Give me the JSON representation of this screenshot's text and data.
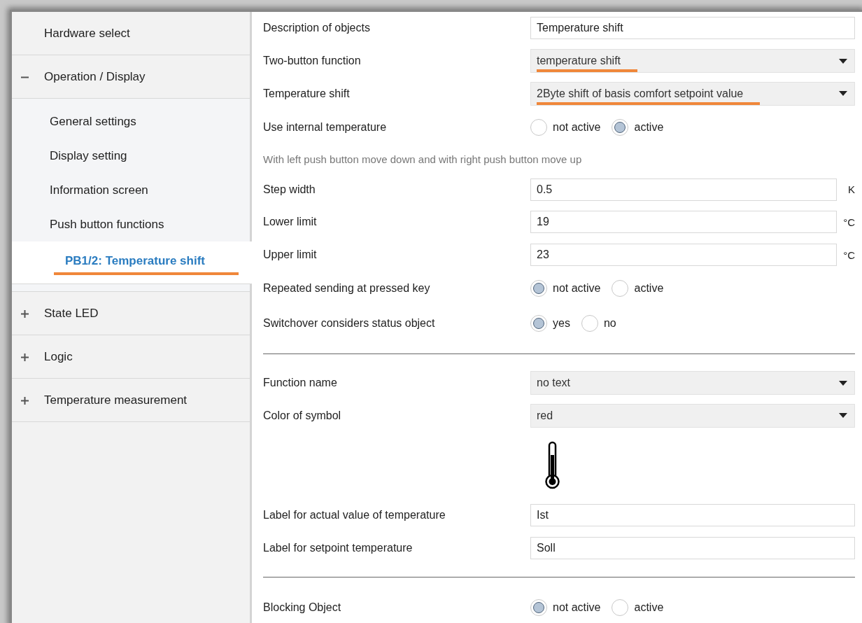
{
  "sidebar": {
    "items": [
      {
        "label": "Hardware select",
        "expandable": false,
        "selected": false
      },
      {
        "label": "Operation / Display",
        "expanded": true,
        "expandable": true,
        "selected": false,
        "children": [
          {
            "label": "General settings",
            "selected": false
          },
          {
            "label": "Display setting",
            "selected": false
          },
          {
            "label": "Information screen",
            "selected": false
          },
          {
            "label": "Push button functions",
            "selected": false,
            "children": [
              {
                "label": "PB1/2: Temperature shift",
                "selected": true
              }
            ]
          }
        ]
      },
      {
        "label": "State LED",
        "expanded": false,
        "expandable": true,
        "selected": false
      },
      {
        "label": "Logic",
        "expanded": false,
        "expandable": true,
        "selected": false
      },
      {
        "label": "Temperature measurement",
        "expanded": false,
        "expandable": true,
        "selected": false
      }
    ]
  },
  "parameters": [
    {
      "kind": "text",
      "label": "Description of objects",
      "value": "Temperature shift"
    },
    {
      "kind": "select",
      "label": "Two-button function",
      "value": "temperature shift",
      "highlighted": true
    },
    {
      "kind": "select",
      "label": "Temperature shift",
      "value": "2Byte shift of basis comfort setpoint value",
      "highlighted": true
    },
    {
      "kind": "radio",
      "label": "Use internal temperature",
      "options": [
        {
          "label": "not active",
          "selected": false
        },
        {
          "label": "active",
          "selected": true
        }
      ]
    },
    {
      "kind": "note",
      "label": "With left push button move down and with right push button move up"
    },
    {
      "kind": "number",
      "label": "Step width",
      "value": "0.5",
      "unit": "K"
    },
    {
      "kind": "number",
      "label": "Lower limit",
      "value": "19",
      "unit": "°C"
    },
    {
      "kind": "number",
      "label": "Upper limit",
      "value": "23",
      "unit": "°C"
    },
    {
      "kind": "radio",
      "label": "Repeated sending at pressed key",
      "options": [
        {
          "label": "not active",
          "selected": true
        },
        {
          "label": "active",
          "selected": false
        }
      ]
    },
    {
      "kind": "radio",
      "label": "Switchover considers status object",
      "options": [
        {
          "label": "yes",
          "selected": true
        },
        {
          "label": "no",
          "selected": false
        }
      ]
    },
    {
      "kind": "divider"
    },
    {
      "kind": "select",
      "label": "Function name",
      "value": "no text",
      "highlighted": false
    },
    {
      "kind": "select",
      "label": "Color of symbol",
      "value": "red",
      "highlighted": false
    },
    {
      "kind": "symbol"
    },
    {
      "kind": "text",
      "label": "Label for actual value of temperature",
      "value": "Ist"
    },
    {
      "kind": "text",
      "label": "Label for setpoint temperature",
      "value": "Soll"
    },
    {
      "kind": "divider"
    },
    {
      "kind": "radio",
      "label": "Blocking Object",
      "options": [
        {
          "label": "not active",
          "selected": true
        },
        {
          "label": "active",
          "selected": false
        }
      ]
    }
  ]
}
